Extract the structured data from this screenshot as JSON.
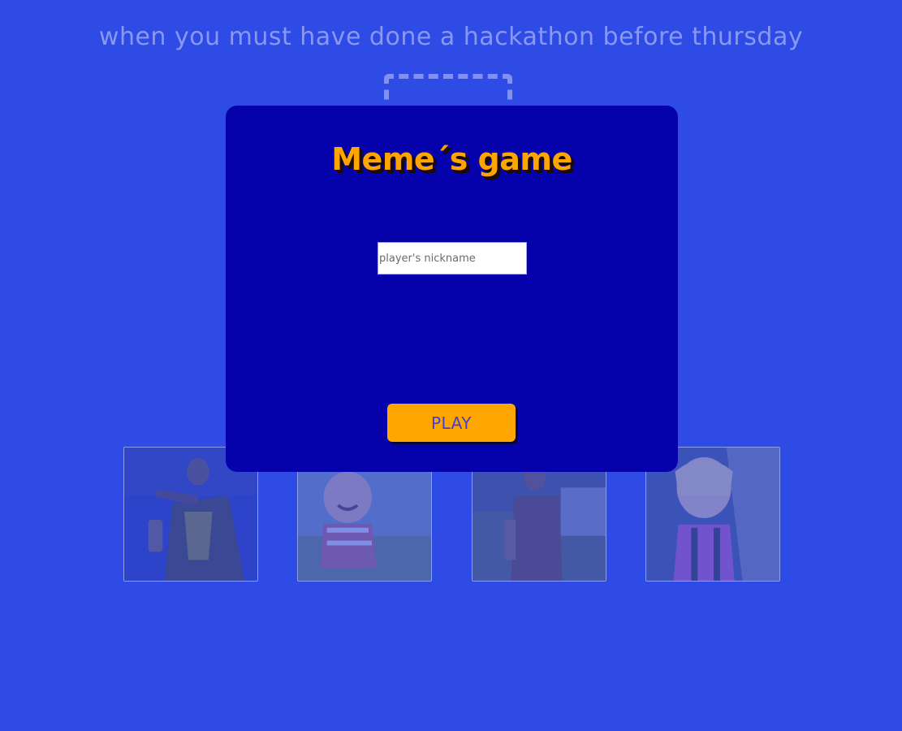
{
  "page": {
    "prompt": "when you must have done a hackathon before thursday"
  },
  "modal": {
    "title": "Meme´s game",
    "nickname_placeholder": "player's nickname",
    "nickname_value": "",
    "play_label": "PLAY"
  },
  "memes": [
    {
      "name": "meme-card-man-pointing"
    },
    {
      "name": "meme-card-laughing-kid"
    },
    {
      "name": "meme-card-bearded-man"
    },
    {
      "name": "meme-card-side-eye-girl"
    }
  ],
  "colors": {
    "background": "#2f4be6",
    "modal": "#0502ac",
    "accent": "#ffa500",
    "prompt_text": "#8898f3"
  }
}
